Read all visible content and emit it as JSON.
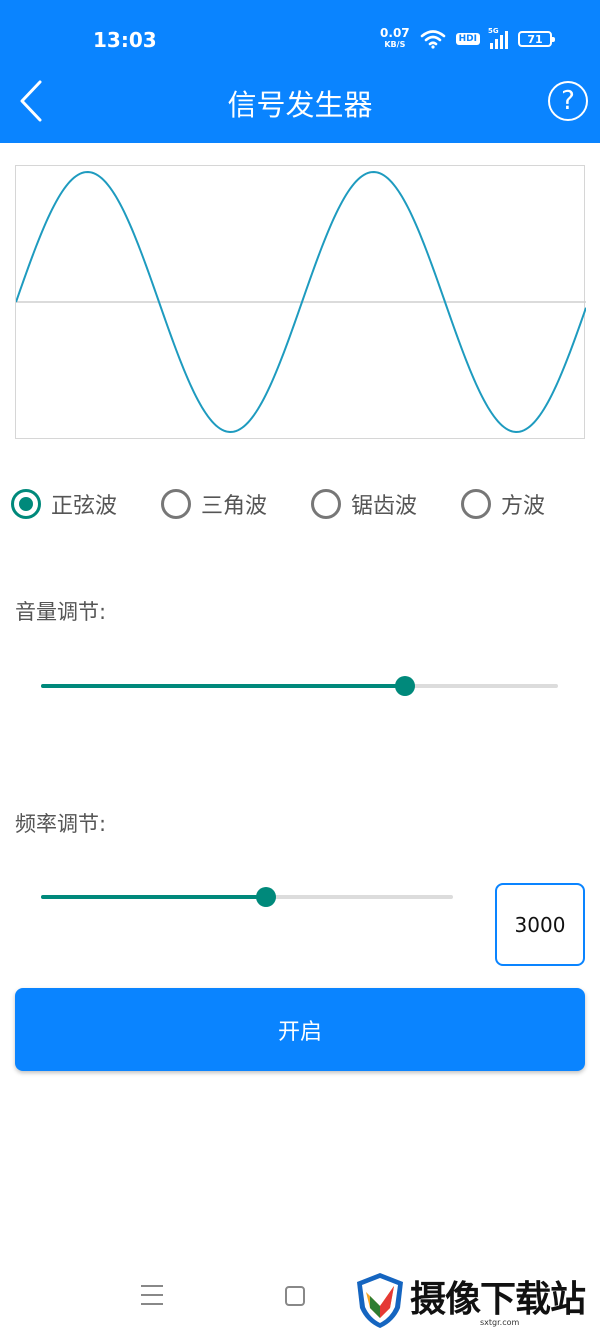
{
  "status_bar": {
    "time": "13:03",
    "net_speed_value": "0.07",
    "net_speed_unit": "KB/S",
    "hd_badge": "HDI",
    "signal_tag": "5G",
    "battery": "71",
    "icons": [
      "wifi-icon",
      "signal-icon",
      "battery-icon"
    ]
  },
  "header": {
    "title": "信号发生器",
    "back_icon": "chevron-left-icon",
    "help_label": "?"
  },
  "wave_types": [
    {
      "label": "正弦波",
      "checked": true
    },
    {
      "label": "三角波",
      "checked": false
    },
    {
      "label": "锯齿波",
      "checked": false
    },
    {
      "label": "方波",
      "checked": false
    }
  ],
  "volume": {
    "label": "音量调节:",
    "level_fraction": 0.705
  },
  "frequency": {
    "label": "频率调节:",
    "level_fraction": 0.545,
    "value": "3000"
  },
  "start_button": {
    "label": "开启"
  },
  "nav": {
    "icons": [
      "menu-icon",
      "home-icon"
    ]
  },
  "watermark": {
    "text": "摄像下载站",
    "sub": "sxtgr.com"
  },
  "colors": {
    "primary": "#0A84FF",
    "accent": "#00897B",
    "wave": "#1E9BBF",
    "track": "#DCDCDC"
  }
}
